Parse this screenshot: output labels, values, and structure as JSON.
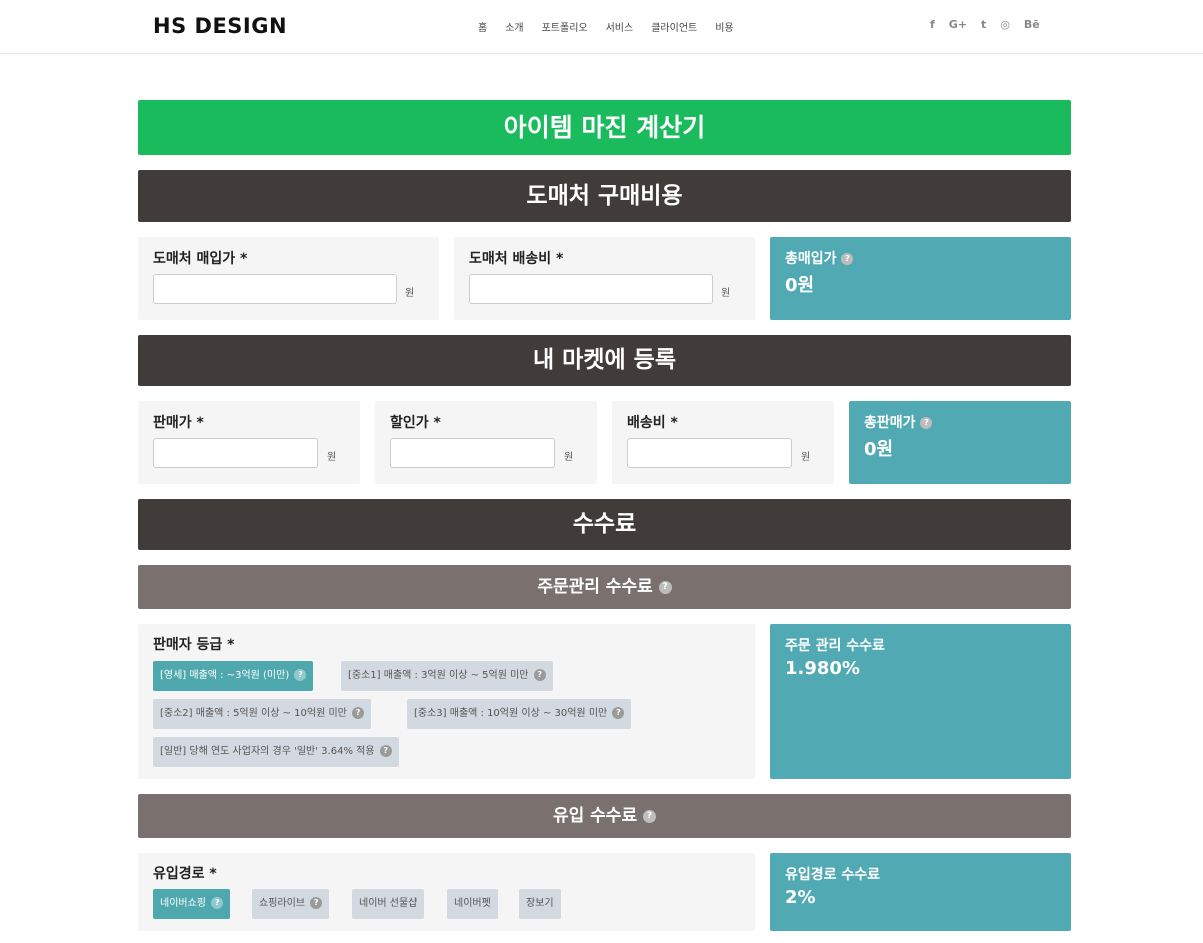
{
  "header": {
    "logo": "HS DESIGN",
    "nav": [
      "홈",
      "소개",
      "포트폴리오",
      "서비스",
      "클라이언트",
      "비용"
    ],
    "social": [
      "f",
      "G+",
      "t",
      "◎",
      "Bē"
    ]
  },
  "title": "아이템 마진 계산기",
  "sections": {
    "wholesale": {
      "heading": "도매처 구매비용",
      "purchase_label": "도매처 매입가 *",
      "shipping_label": "도매처 배송비 *",
      "unit": "원",
      "total_label": "총매입가",
      "total_value": "0원"
    },
    "market": {
      "heading": "내 마켓에 등록",
      "price_label": "판매가 *",
      "discount_label": "할인가 *",
      "shipping_label": "배송비 *",
      "unit": "원",
      "total_label": "총판매가",
      "total_value": "0원"
    },
    "fees": {
      "heading": "수수료",
      "order_heading": "주문관리 수수료",
      "grade_label": "판매자 등급 *",
      "grades": [
        "[영세] 매출액 : ~3억원 (미만)",
        "[중소1] 매출액 : 3억원 이상 ~ 5억원 미만",
        "[중소2] 매출액 : 5억원 이상 ~ 10억원 미만",
        "[중소3] 매출액 : 10억원 이상 ~ 30억원 미만",
        "[일반] 당해 연도 사업자의 경우 '일반' 3.64% 적용"
      ],
      "order_fee_label": "주문 관리 수수료",
      "order_fee_value": "1.980%",
      "inflow_heading": "유입 수수료",
      "inflow_label": "유입경로 *",
      "inflows": [
        "네이버쇼핑",
        "쇼핑라이브",
        "네이버 선물샵",
        "네이버펫",
        "장보기"
      ],
      "inflow_fee_label": "유입경로 수수료",
      "inflow_fee_value": "2%"
    }
  },
  "help_glyph": "?",
  "colors": {
    "green": "#1abb5d",
    "dark": "#413b3a",
    "sub": "#7a716e",
    "teal": "#51aab3"
  }
}
